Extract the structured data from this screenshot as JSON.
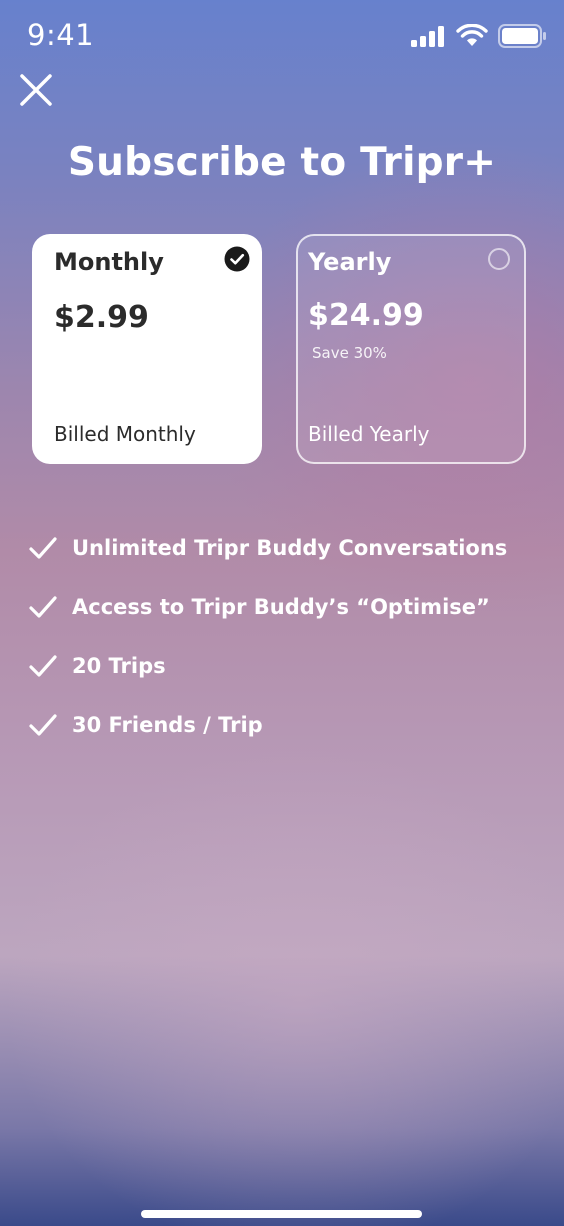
{
  "status_bar": {
    "time": "9:41"
  },
  "icons": {
    "close": "close-icon",
    "signal": "cellular-signal-icon",
    "wifi": "wifi-icon",
    "battery": "battery-icon",
    "check": "checkmark-icon",
    "selected": "check-circle-icon",
    "unselected": "radio-empty-icon"
  },
  "title": "Subscribe to Tripr+",
  "plans": {
    "monthly": {
      "name": "Monthly",
      "price": "$2.99",
      "billing": "Billed Monthly",
      "selected": true
    },
    "yearly": {
      "name": "Yearly",
      "price": "$24.99",
      "savings": "Save 30%",
      "billing": "Billed Yearly",
      "selected": false
    }
  },
  "features": [
    {
      "prefix": "Unlimited ",
      "bold": "Tripr Buddy",
      "suffix": " Conversations"
    },
    {
      "prefix": "Access to Tripr Buddy’s “",
      "bold": "Optimise",
      "suffix": "”"
    },
    {
      "prefix": "",
      "bold": "20 Trips",
      "suffix": ""
    },
    {
      "prefix": "",
      "bold": "30 Friends / Trip",
      "suffix": ""
    }
  ],
  "colors": {
    "background_top": "#6781cd",
    "background_mid": "#b18ba8",
    "background_bottom": "#3a4a8a",
    "card_selected": "#ffffff",
    "text_dark": "#2b2b2b"
  }
}
